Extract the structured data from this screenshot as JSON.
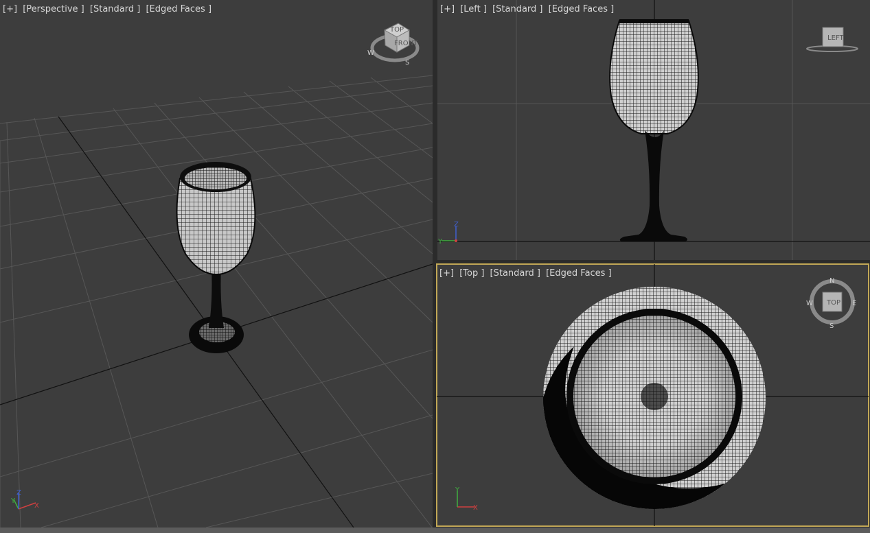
{
  "viewports": {
    "perspective": {
      "plus": "[+]",
      "view": "[Perspective ]",
      "shading": "[Standard ]",
      "edges": "[Edged Faces ]",
      "viewcube_label_top": "TOP",
      "viewcube_label_front": "FRONT",
      "compass_w": "W",
      "compass_s": "S",
      "axis_x": "X",
      "axis_y": "Y",
      "axis_z": "Z"
    },
    "left": {
      "plus": "[+]",
      "view": "[Left ]",
      "shading": "[Standard ]",
      "edges": "[Edged Faces ]",
      "viewcube_label": "LEFT",
      "axis_y": "Y",
      "axis_z": "Z"
    },
    "top": {
      "plus": "[+]",
      "view": "[Top ]",
      "shading": "[Standard ]",
      "edges": "[Edged Faces ]",
      "viewcube_label": "TOP",
      "compass_n": "N",
      "compass_e": "E",
      "compass_s": "S",
      "compass_w": "W",
      "axis_x": "X",
      "axis_y": "Y"
    }
  },
  "colors": {
    "viewport_bg": "#3d3d3d",
    "grid": "#555555",
    "axis_line": "#111111",
    "active_border": "#c2a856",
    "x_axis": "#d04040",
    "y_axis": "#40b040",
    "z_axis": "#4060d0"
  }
}
